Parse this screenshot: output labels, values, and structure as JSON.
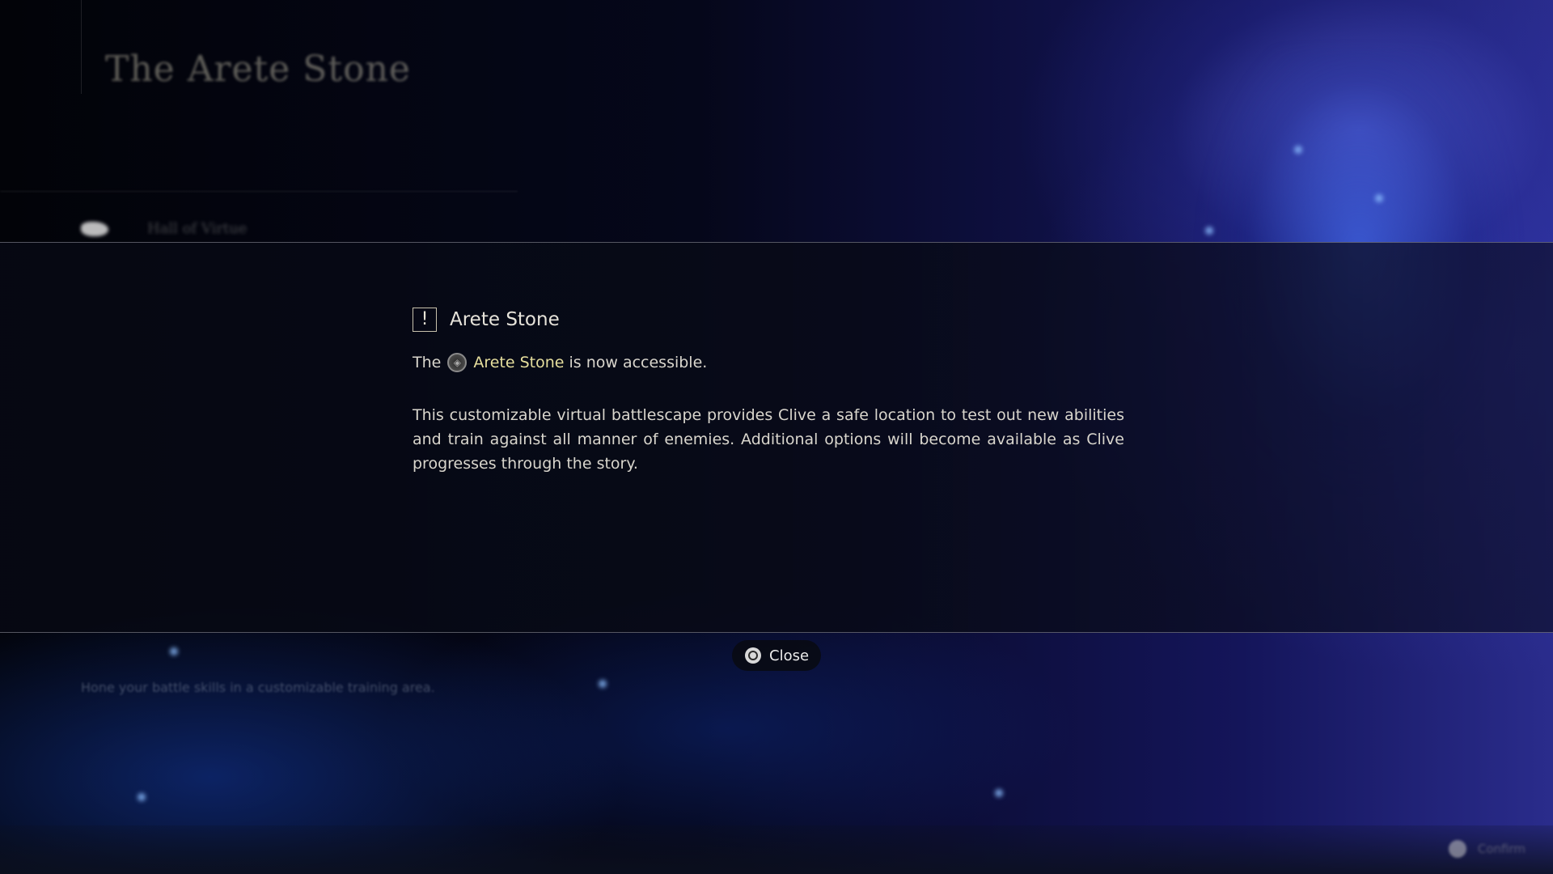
{
  "background_page": {
    "title": "The Arete Stone",
    "nav_label": "Hall of Virtue",
    "hint": "Hone your battle skills in a customizable training area.",
    "confirm_label": "Confirm"
  },
  "dialog": {
    "heading": "Arete Stone",
    "line_prefix": "The",
    "highlight_name": "Arete Stone",
    "line_suffix": "is now accessible.",
    "description": "This customizable virtual battlescape provides Clive a safe location to test out new abilities and train against all manner of enemies. Additional options will become available as Clive progresses through the story.",
    "alert_glyph": "!",
    "stone_glyph": "◈",
    "highlight_color": "#e7df9e",
    "close_label": "Close",
    "icons": {
      "alert": "exclamation-box-icon",
      "stone": "arete-stone-icon",
      "close": "circle-button-icon"
    }
  }
}
